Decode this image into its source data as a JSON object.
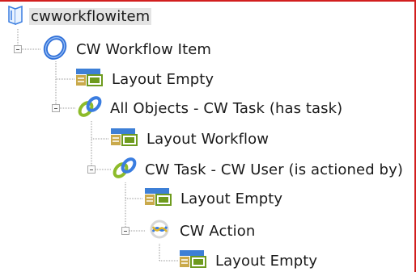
{
  "tree": {
    "root": {
      "label": "cwworkflowitem",
      "icon": "book-icon"
    },
    "nodes": [
      {
        "label": "CW Workflow Item",
        "icon": "blue-ring-icon"
      },
      {
        "label": "Layout Empty",
        "icon": "layout-icon"
      },
      {
        "label": "All Objects - CW Task (has task)",
        "icon": "chain-link-icon"
      },
      {
        "label": "Layout Workflow",
        "icon": "layout-icon"
      },
      {
        "label": "CW Task - CW User (is actioned by)",
        "icon": "chain-link-icon"
      },
      {
        "label": "Layout Empty",
        "icon": "layout-icon"
      },
      {
        "label": "CW Action",
        "icon": "action-ring-icon"
      },
      {
        "label": "Layout Empty",
        "icon": "layout-icon"
      }
    ]
  },
  "colors": {
    "frame_border": "#d21e1e",
    "root_highlight": "#e4e4e4",
    "ring_blue": "#2f6fd8",
    "link_green": "#8dbb2a",
    "link_blue": "#3a7de0",
    "layout_blue": "#3d7fd6",
    "layout_green": "#6e9b1e",
    "layout_tan": "#c9a94b",
    "tree_line": "#9a9a9a"
  }
}
